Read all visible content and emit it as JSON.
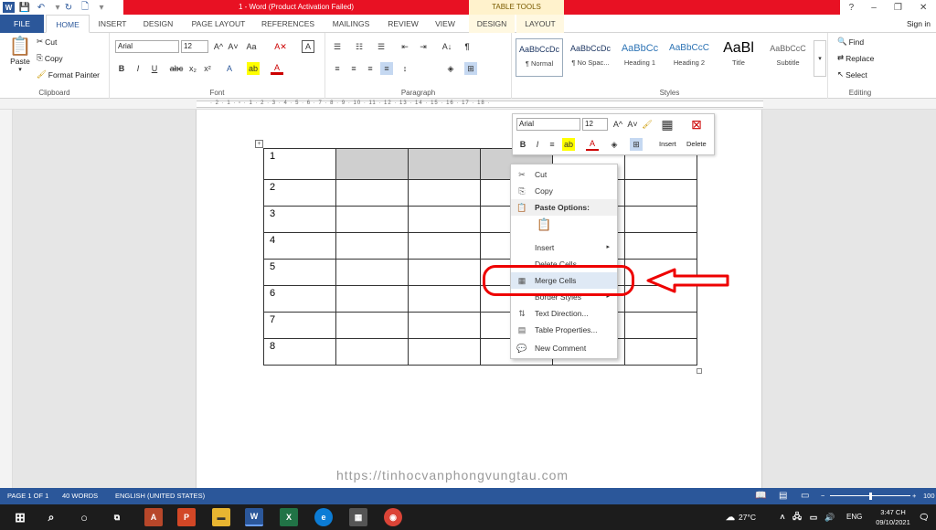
{
  "window": {
    "title": "1 - Word (Product Activation Failed)",
    "table_tools_label": "TABLE TOOLS",
    "min": "–",
    "restore": "❐",
    "close": "✕",
    "help": "?"
  },
  "qat": {
    "word_icon": "W",
    "save_icon": "💾",
    "undo_icon": "↶",
    "redo_icon": "↻",
    "new_icon": "🗋"
  },
  "tabs": [
    "FILE",
    "HOME",
    "INSERT",
    "DESIGN",
    "PAGE LAYOUT",
    "REFERENCES",
    "MAILINGS",
    "REVIEW",
    "VIEW",
    "DESIGN",
    "LAYOUT"
  ],
  "signin": "Sign in",
  "ribbon": {
    "clipboard": {
      "paste": "Paste",
      "cut": "Cut",
      "copy": "Copy",
      "format_painter": "Format Painter",
      "label": "Clipboard"
    },
    "font": {
      "name": "Arial",
      "size": "12",
      "label": "Font",
      "bold": "B",
      "italic": "I",
      "underline": "U",
      "strike": "abc",
      "sub": "x₂",
      "sup": "x²",
      "grow": "A^",
      "shrink": "A˅",
      "case": "Aa",
      "clear": "A✕",
      "color": "A",
      "highlight": "ab",
      "effects": "A"
    },
    "paragraph": {
      "label": "Paragraph",
      "pilcrow": "¶",
      "bullets": "☰",
      "sort": "A↓"
    },
    "styles": {
      "label": "Styles",
      "items": [
        {
          "sample": "AaBbCcDc",
          "name": "¶ Normal"
        },
        {
          "sample": "AaBbCcDc",
          "name": "¶ No Spac..."
        },
        {
          "sample": "AaBbCc",
          "name": "Heading 1"
        },
        {
          "sample": "AaBbCcC",
          "name": "Heading 2"
        },
        {
          "sample": "AaBl",
          "name": "Title"
        },
        {
          "sample": "AaBbCcC",
          "name": "Subtitle"
        }
      ]
    },
    "editing": {
      "label": "Editing",
      "find": "Find",
      "replace": "Replace",
      "select": "Select"
    }
  },
  "ruler_marks": "· 2 · 1 · ▫ · 1 · 2 · 3 · 4 · 5 · 6 · 7 · 8 · 9 · 10 · 11 · 12 · 13 · 14 · 15 · 16 · 17 · 18 ·",
  "table": {
    "rows": [
      "1",
      "2",
      "3",
      "4",
      "5",
      "6",
      "7",
      "8"
    ],
    "cols": 6,
    "handle": "+"
  },
  "minibar": {
    "font": "Arial",
    "size": "12",
    "insert": "Insert",
    "delete": "Delete",
    "bold": "B",
    "italic": "I"
  },
  "context_menu": [
    {
      "label": "Cut",
      "icon": "✂",
      "submenu": false,
      "disabled": false
    },
    {
      "label": "Copy",
      "icon": "⎘",
      "submenu": false,
      "disabled": false
    },
    {
      "label": "Paste Options:",
      "icon": "📋",
      "submenu": false,
      "disabled": false
    },
    {
      "label": "",
      "icon": "📋",
      "submenu": false,
      "disabled": false
    },
    {
      "label": "Insert",
      "icon": "",
      "submenu": true,
      "disabled": false
    },
    {
      "label": "Delete Cells...",
      "icon": "",
      "submenu": false,
      "disabled": false
    },
    {
      "label": "Merge Cells",
      "icon": "▦",
      "submenu": false,
      "disabled": false
    },
    {
      "label": "Border Styles",
      "icon": "",
      "submenu": true,
      "disabled": false
    },
    {
      "label": "Text Direction...",
      "icon": "⇅",
      "submenu": false,
      "disabled": false
    },
    {
      "label": "Table Properties...",
      "icon": "▤",
      "submenu": false,
      "disabled": false
    },
    {
      "label": "New Comment",
      "icon": "💬",
      "submenu": false,
      "disabled": false
    }
  ],
  "watermark": "https://tinhocvanphongvungtau.com",
  "status": {
    "page": "PAGE 1 OF 1",
    "words": "40 WORDS",
    "language": "ENGLISH (UNITED STATES)",
    "zoom": "100"
  },
  "taskbar": {
    "temp": "27°C",
    "lang": "ENG",
    "time": "3:47 CH",
    "date": "09/10/2021"
  },
  "colors": {
    "word_blue": "#2b579a",
    "error_red": "#e81123",
    "annotation_red": "#e00000"
  }
}
